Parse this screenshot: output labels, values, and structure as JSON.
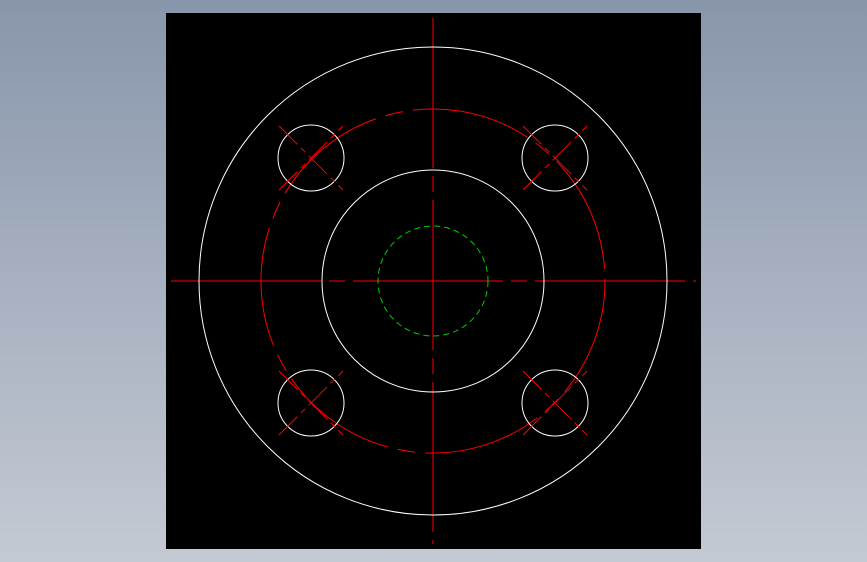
{
  "drawing": {
    "background": "#000000",
    "colors": {
      "outline": "#ffffff",
      "centerline": "#ff0000",
      "hidden": "#00cc00"
    },
    "bolt_hole_count": 4
  }
}
